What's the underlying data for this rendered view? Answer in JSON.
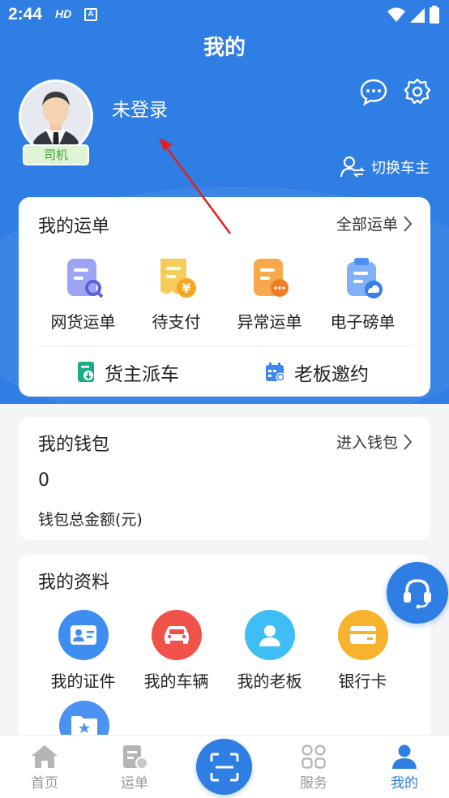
{
  "status_bar": {
    "time": "2:44",
    "hd_label": "HD",
    "a_label": "A"
  },
  "header": {
    "title": "我的",
    "login_status": "未登录",
    "role_badge": "司机",
    "switch_label": "切换车主",
    "icons": [
      "message-icon",
      "settings-icon"
    ]
  },
  "waybill": {
    "title": "我的运单",
    "all_link": "全部运单",
    "items": [
      {
        "label": "网货运单",
        "icon": "doc-search-icon",
        "color": "#8b8ff0"
      },
      {
        "label": "待支付",
        "icon": "receipt-yen-icon",
        "color": "#f6bd3c"
      },
      {
        "label": "异常运单",
        "icon": "doc-alert-icon",
        "color": "#f5973a"
      },
      {
        "label": "电子磅单",
        "icon": "clipboard-cloud-icon",
        "color": "#4b8ff2"
      }
    ],
    "actions": [
      {
        "label": "货主派车",
        "icon": "dispatch-doc-icon",
        "color": "#1bab86"
      },
      {
        "label": "老板邀约",
        "icon": "calendar-invite-icon",
        "color": "#3f86ee"
      }
    ]
  },
  "wallet": {
    "title": "我的钱包",
    "enter_link": "进入钱包",
    "amount": "0",
    "amount_label": "钱包总金额(元)"
  },
  "profile": {
    "title": "我的资料",
    "items": [
      {
        "label": "我的证件",
        "icon": "id-card-icon",
        "color": "#3d8ef0"
      },
      {
        "label": "我的车辆",
        "icon": "car-icon",
        "color": "#f0524a"
      },
      {
        "label": "我的老板",
        "icon": "person-icon",
        "color": "#3fbdf5"
      },
      {
        "label": "银行卡",
        "icon": "bank-card-icon",
        "color": "#f7b22e"
      }
    ],
    "extra_icon": "folder-star-icon"
  },
  "tabbar": {
    "tabs": [
      {
        "label": "首页",
        "icon": "home-icon"
      },
      {
        "label": "运单",
        "icon": "waybill-icon"
      },
      {
        "label": "服务",
        "icon": "grid-icon"
      },
      {
        "label": "我的",
        "icon": "user-icon",
        "active": true
      }
    ],
    "scan_icon": "scan-icon"
  },
  "colors": {
    "primary": "#2f7ee3",
    "badge_green": "#3aa237",
    "annotation_red": "#e02020"
  }
}
